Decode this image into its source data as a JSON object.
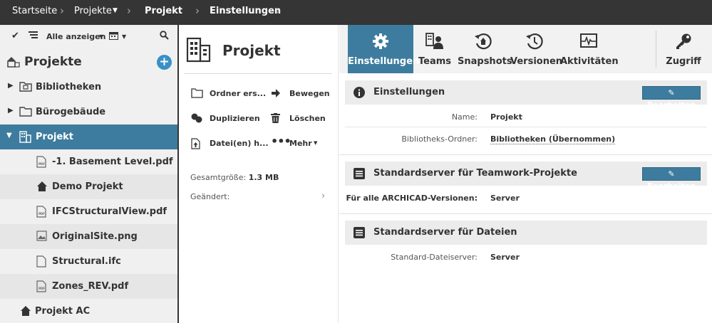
{
  "breadcrumb": {
    "items": [
      "Startseite",
      "Projekte",
      "Projekt",
      "Einstellungen"
    ]
  },
  "sidebar": {
    "filter_label": "Alle anzeigen",
    "title": "Projekte",
    "add_label": "+",
    "items": [
      {
        "label": "Bibliotheken",
        "icon": "library-folder-icon"
      },
      {
        "label": "Bürogebäude",
        "icon": "folder-icon"
      },
      {
        "label": "Projekt",
        "icon": "building-icon"
      },
      {
        "label": "-1. Basement Level.pdf",
        "icon": "pdf-file-icon"
      },
      {
        "label": "Demo Projekt",
        "icon": "teamwork-project-icon"
      },
      {
        "label": "IFCStructuralView.pdf",
        "icon": "pdf-file-icon"
      },
      {
        "label": "OriginalSite.png",
        "icon": "image-file-icon"
      },
      {
        "label": "Structural.ifc",
        "icon": "file-icon"
      },
      {
        "label": "Zones_REV.pdf",
        "icon": "pdf-file-icon"
      },
      {
        "label": "Projekt AC",
        "icon": "teamwork-project-icon"
      }
    ]
  },
  "middle": {
    "title": "Projekt",
    "actions": {
      "new_folder": "Ordner ers...",
      "move": "Bewegen",
      "duplicate": "Duplizieren",
      "delete": "Löschen",
      "upload": "Datei(en) h...",
      "more": "Mehr"
    },
    "total_size_label": "Gesamtgröße:",
    "total_size_value": "1.3 MB",
    "modified_label": "Geändert:"
  },
  "tabs": [
    {
      "label": "Einstellungen",
      "icon": "gear-icon",
      "active": true
    },
    {
      "label": "Teams",
      "icon": "team-icon",
      "active": false
    },
    {
      "label": "Snapshots",
      "icon": "snapshot-icon",
      "active": false
    },
    {
      "label": "Versionen",
      "icon": "versions-icon",
      "active": false
    },
    {
      "label": "Aktivitäten",
      "icon": "activity-icon",
      "active": false
    },
    {
      "label": "Zugriff",
      "icon": "key-icon",
      "active": false
    }
  ],
  "sections": {
    "settings": {
      "title": "Einstellungen",
      "edit_label": "Bearbeiten",
      "fields": [
        {
          "label": "Name:",
          "value": "Projekt"
        },
        {
          "label": "Bibliotheks-Ordner:",
          "value": "Bibliotheken (Übernommen)"
        }
      ]
    },
    "teamwork_server": {
      "title": "Standardserver für Teamwork-Projekte",
      "edit_label": "Bearbeiten",
      "fields": [
        {
          "label": "Für alle ARCHICAD-Versionen:",
          "value": "Server"
        }
      ]
    },
    "file_server": {
      "title": "Standardserver für Dateien",
      "fields": [
        {
          "label": "Standard-Dateiserver:",
          "value": "Server"
        }
      ]
    }
  },
  "colors": {
    "accent": "#3d7c9e",
    "topbar": "#353535",
    "add_button": "#3a8fc7"
  }
}
